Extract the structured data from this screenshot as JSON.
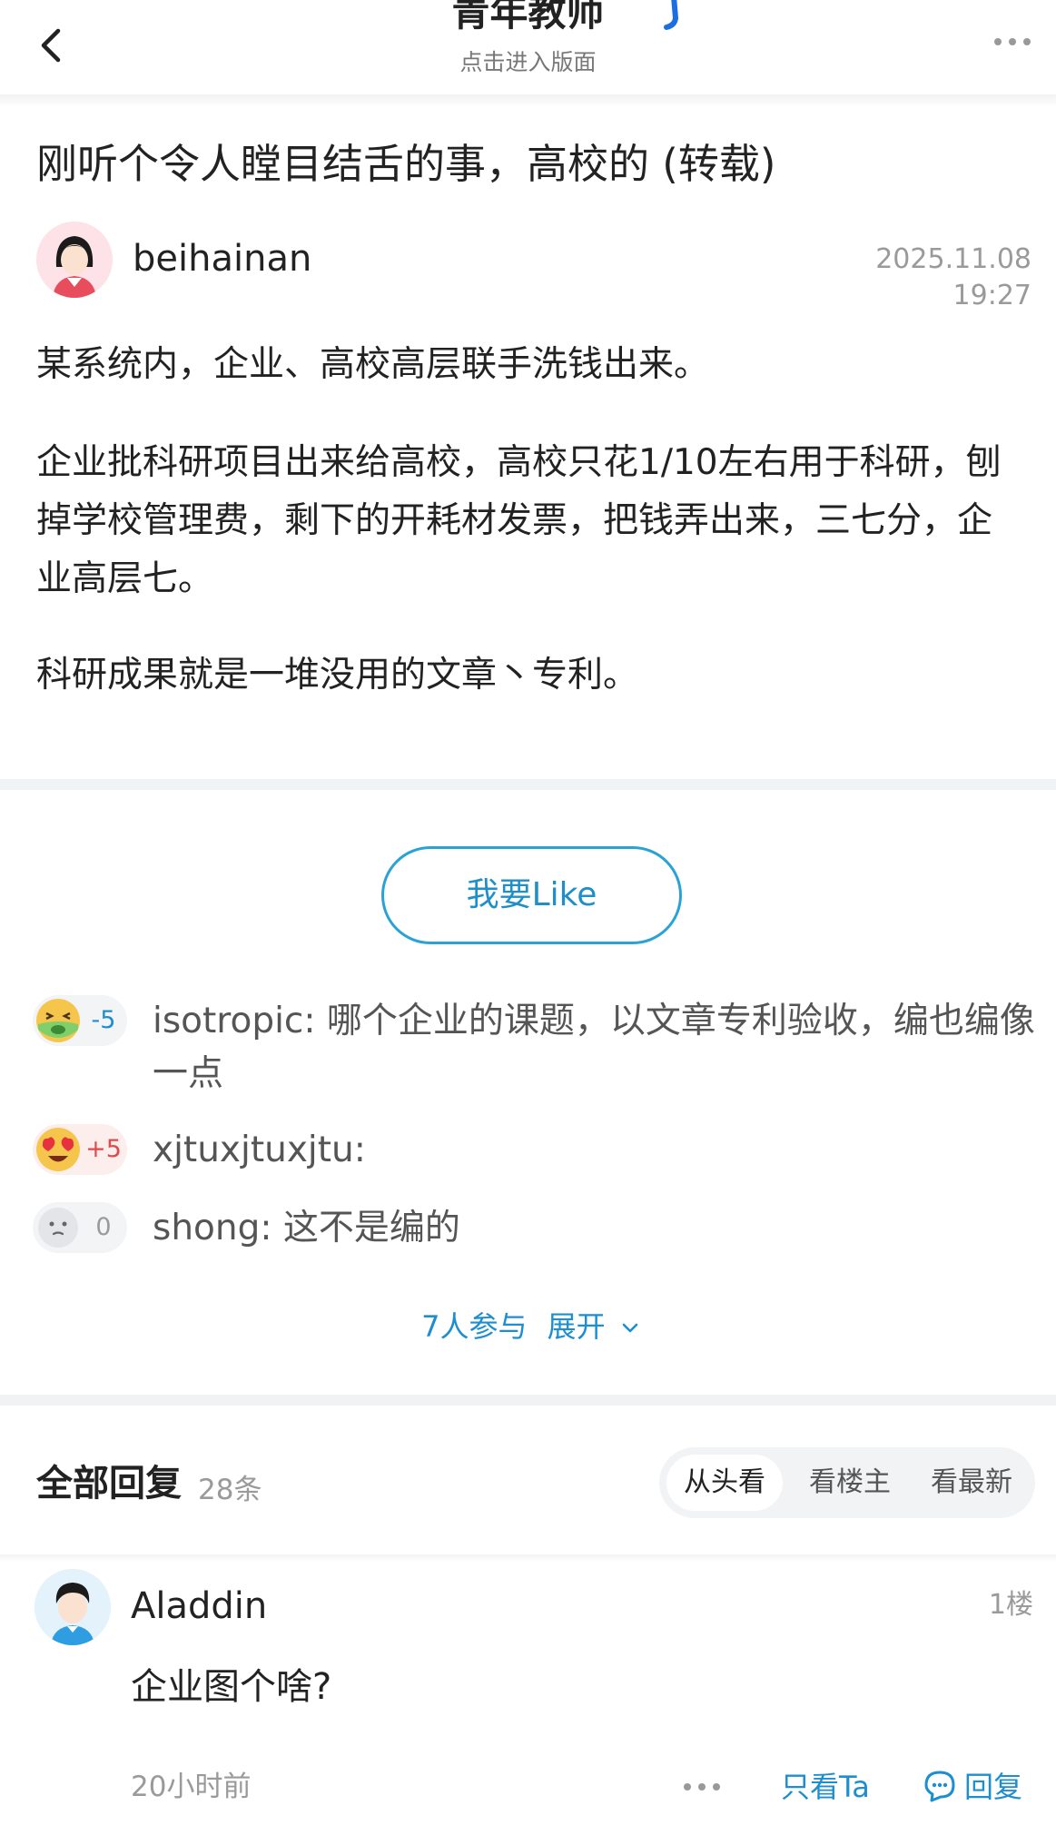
{
  "header": {
    "board_title": "青年教师",
    "board_subtitle": "点击进入版面"
  },
  "post": {
    "title": "刚听个令人瞠目结舌的事，高校的 (转载)",
    "author": "beihainan",
    "time": "2025.11.08 19:27",
    "paragraphs": [
      "某系统内，企业、高校高层联手洗钱出来。",
      "企业批科研项目出来给高校，高校只花1/10左右用于科研，刨掉学校管理费，剩下的开耗材发票，把钱弄出来，三七分，企业高层七。",
      "科研成果就是一堆没用的文章丶专利。"
    ],
    "like_button": "我要Like"
  },
  "quick_comments": [
    {
      "score": "-5",
      "text": "isotropic: 哪个企业的课题，以文章专利验收，编也编像一点",
      "emoji": "sick-face-icon",
      "score_color": "#1d8ed0"
    },
    {
      "score": "+5",
      "text": "xjtuxjtuxjtu:",
      "emoji": "heart-eyes-icon",
      "score_color": "#e04a4a"
    },
    {
      "score": "0",
      "text": "shong: 这不是编的",
      "emoji": "neutral-face-icon",
      "score_color": "#9a9a9a"
    }
  ],
  "participants": {
    "count_label": "7人参与",
    "expand_label": "展开"
  },
  "replies_section": {
    "title": "全部回复",
    "count": "28条",
    "sort_options": [
      "从头看",
      "看楼主",
      "看最新"
    ],
    "selected_sort": "从头看"
  },
  "reply": {
    "user": "Aladdin",
    "floor": "1楼",
    "text": "企业图个啥?",
    "time": "20小时前",
    "only_ta": "只看Ta",
    "reply_label": "回复"
  },
  "colors": {
    "accent": "#1d8ed0",
    "like_border": "#29a3d6",
    "muted_text": "#9a9a9a"
  }
}
